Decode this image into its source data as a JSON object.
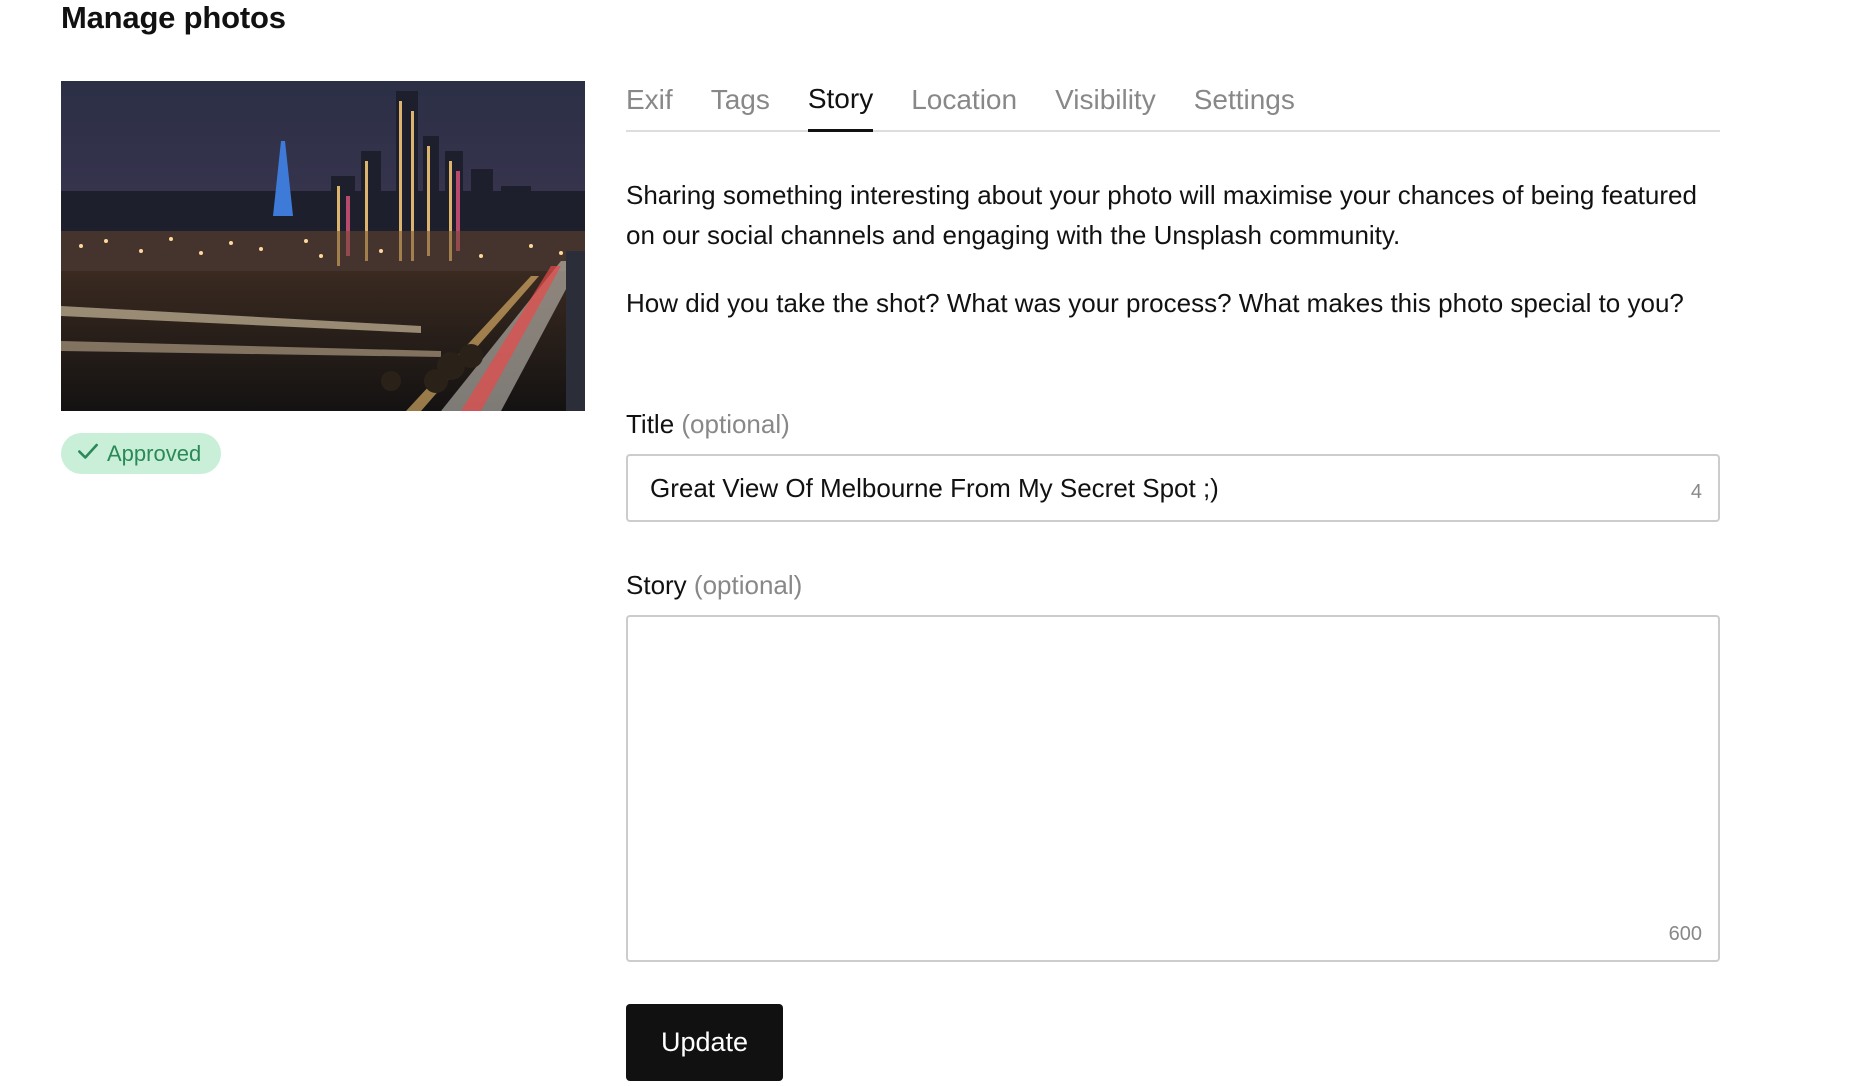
{
  "page": {
    "title": "Manage photos"
  },
  "photo": {
    "status_badge": "Approved",
    "status_icon": "check-icon",
    "badge_color": "#2a8a57",
    "badge_bg": "#c9efd9"
  },
  "tabs": [
    {
      "label": "Exif",
      "active": false
    },
    {
      "label": "Tags",
      "active": false
    },
    {
      "label": "Story",
      "active": true
    },
    {
      "label": "Location",
      "active": false
    },
    {
      "label": "Visibility",
      "active": false
    },
    {
      "label": "Settings",
      "active": false
    }
  ],
  "intro": {
    "paragraph1": "Sharing something interesting about your photo will maximise your chances of being featured on our social channels and engaging with the Unsplash community.",
    "paragraph2": "How did you take the shot? What was your process? What makes this photo special to you?"
  },
  "form": {
    "title_label": "Title",
    "title_optional": "(optional)",
    "title_value": "Great View Of Melbourne From My Secret Spot ;)",
    "title_counter": "4",
    "story_label": "Story",
    "story_optional": "(optional)",
    "story_value": "",
    "story_counter": "600",
    "submit_label": "Update"
  }
}
